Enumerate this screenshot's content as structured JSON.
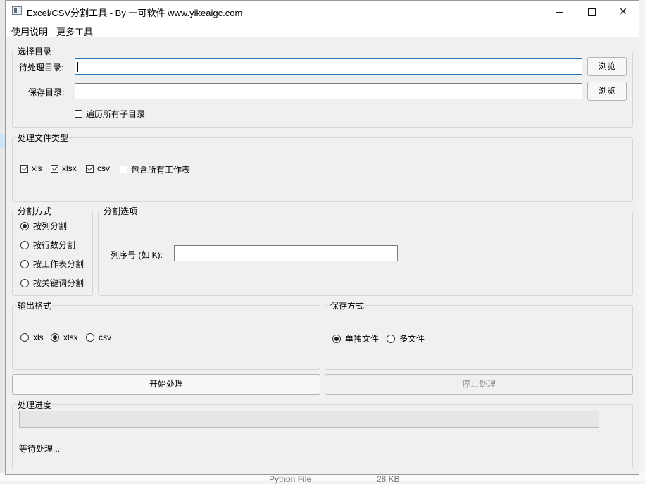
{
  "window": {
    "title": "Excel/CSV分割工具 - By 一可软件 www.yikeaigc.com",
    "controls": {
      "minimize": "",
      "maximize": "",
      "close": "✕"
    }
  },
  "menu": {
    "items": [
      "使用说明",
      "更多工具"
    ]
  },
  "dir_group": {
    "title": "选择目录",
    "input_label": "待处理目录:",
    "input_value": "",
    "save_label": "保存目录:",
    "save_value": "",
    "browse_label": "浏览",
    "recurse_label": "遍历所有子目录",
    "recurse_checked": false
  },
  "filetype_group": {
    "title": "处理文件类型",
    "options": [
      {
        "label": "xls",
        "checked": true
      },
      {
        "label": "xlsx",
        "checked": true
      },
      {
        "label": "csv",
        "checked": true
      },
      {
        "label": "包含所有工作表",
        "checked": false
      }
    ]
  },
  "split_mode_group": {
    "title": "分割方式",
    "options": [
      "按列分割",
      "按行数分割",
      "按工作表分割",
      "按关键词分割"
    ],
    "selected": "按列分割"
  },
  "split_options_group": {
    "title": "分割选项",
    "column_label": "列序号 (如 K):",
    "column_value": ""
  },
  "output_format_group": {
    "title": "输出格式",
    "options": [
      "xls",
      "xlsx",
      "csv"
    ],
    "selected": "xlsx"
  },
  "save_mode_group": {
    "title": "保存方式",
    "options": [
      "单独文件",
      "多文件"
    ],
    "selected": "单独文件"
  },
  "actions": {
    "start_label": "开始处理",
    "stop_label": "停止处理",
    "stop_enabled": false
  },
  "progress_group": {
    "title": "处理进度",
    "progress_fraction": 0,
    "status_text": "等待处理..."
  },
  "background": {
    "file_type_text": "Python File",
    "file_size_text": "28 KB"
  },
  "colors": {
    "focus_border": "#2877c7",
    "window_bg": "#f0f0f0",
    "titlebar_bg": "#ffffff"
  }
}
